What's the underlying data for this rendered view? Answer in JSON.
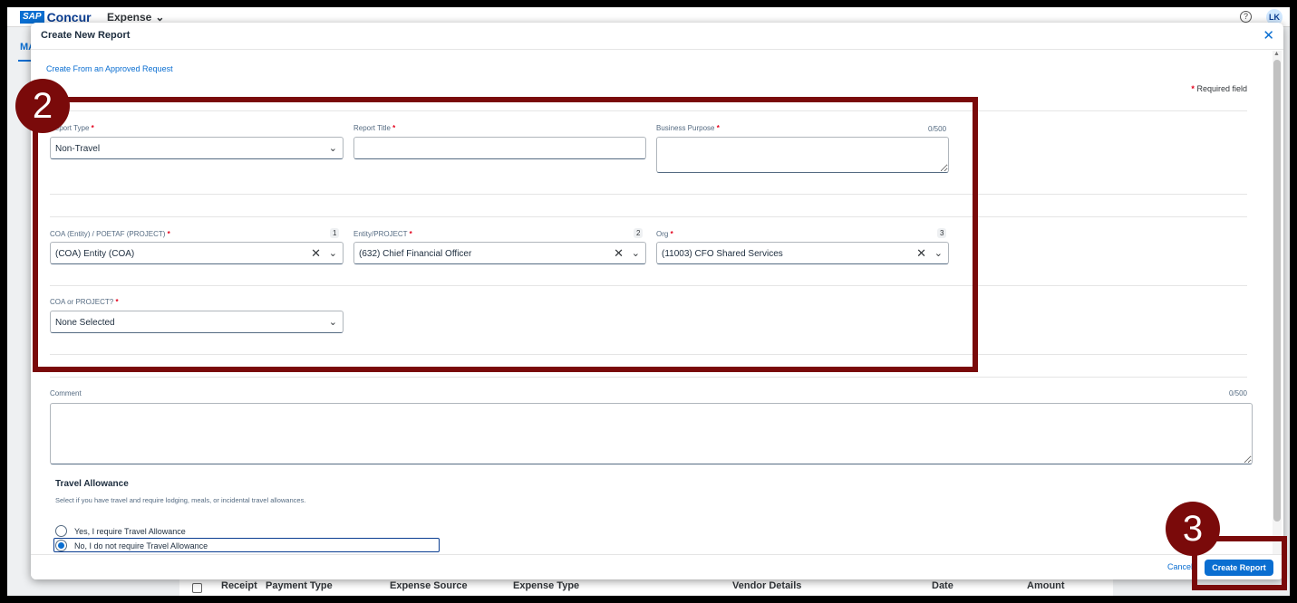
{
  "app": {
    "logo_badge": "SAP",
    "logo_text": "Concur",
    "menu": "Expense",
    "help": "?",
    "avatar": "LK",
    "bg_tab": "MA",
    "bg_table_headers": [
      "Receipt",
      "Payment Type",
      "Expense Source",
      "Expense Type",
      "Vendor Details",
      "Date",
      "Amount"
    ]
  },
  "modal": {
    "title": "Create New Report",
    "create_from_request_link": "Create From an Approved Request",
    "required_note": "Required field",
    "required_star": "*",
    "fields": {
      "report_type": {
        "label": "Report Type",
        "value": "Non-Travel"
      },
      "report_title": {
        "label": "Report Title",
        "value": ""
      },
      "business_purpose": {
        "label": "Business Purpose",
        "count": "0/500",
        "value": ""
      },
      "coa_entity": {
        "label": "COA (Entity) / POETAF (PROJECT)",
        "badge": "1",
        "value": "(COA) Entity (COA)"
      },
      "entity_project": {
        "label": "Entity/PROJECT",
        "badge": "2",
        "value": "(632) Chief Financial Officer"
      },
      "org": {
        "label": "Org",
        "badge": "3",
        "value": "(11003) CFO Shared Services"
      },
      "coa_or_project": {
        "label": "COA or PROJECT?",
        "value": "None Selected"
      },
      "comment": {
        "label": "Comment",
        "count": "0/500",
        "value": ""
      }
    },
    "travel_allowance": {
      "title": "Travel Allowance",
      "description": "Select if you have travel and require lodging, meals, or incidental travel allowances.",
      "options": [
        {
          "label": "Yes, I require Travel Allowance",
          "selected": false
        },
        {
          "label": "No, I do not require Travel Allowance",
          "selected": true
        }
      ]
    },
    "footer": {
      "cancel": "Cancel",
      "create": "Create Report"
    }
  },
  "annotations": {
    "step_2": "2",
    "step_3": "3",
    "color": "#7a0a0a"
  },
  "colors": {
    "accent": "#0a6ed1",
    "required": "#e3001b"
  }
}
